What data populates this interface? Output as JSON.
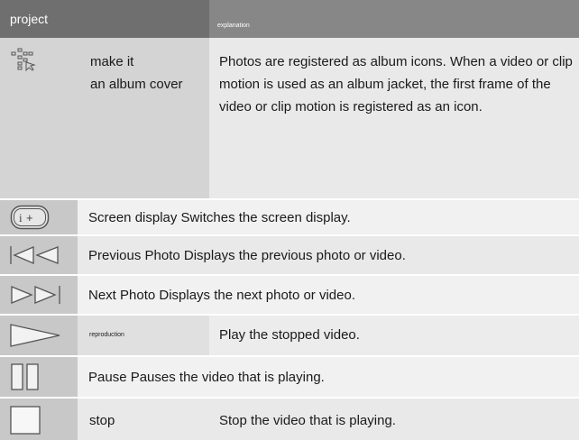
{
  "header": {
    "col1": "project",
    "col2": "explanation"
  },
  "rows": [
    {
      "icon": "album-cover-icon",
      "name_line1": "make it",
      "name_line2": "an album cover",
      "description": "Photos are registered as album icons. When a video or clip motion is used as an album jacket, the first frame of the video or clip motion is registered as an icon."
    },
    {
      "icon": "screen-display-icon",
      "text": "Screen display Switches the screen display."
    },
    {
      "icon": "previous-photo-icon",
      "text": "Previous Photo Displays the previous photo or video."
    },
    {
      "icon": "next-photo-icon",
      "text": "Next Photo Displays the next photo or video."
    },
    {
      "icon": "play-icon",
      "name": "reproduction",
      "description": "Play the stopped video."
    },
    {
      "icon": "pause-icon",
      "text": "Pause Pauses the video that is playing."
    },
    {
      "icon": "stop-icon",
      "name": "stop",
      "description": "Stop the video that is playing."
    }
  ]
}
